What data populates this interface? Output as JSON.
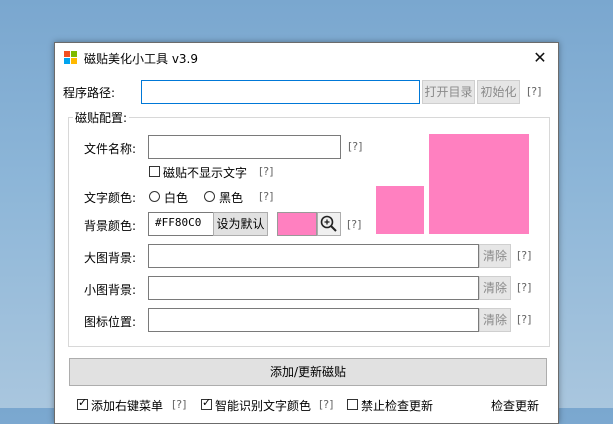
{
  "window": {
    "title": "磁贴美化小工具 v3.9",
    "close_glyph": "✕"
  },
  "program_path": {
    "label": "程序路径:",
    "value": "",
    "open_dir_button": "打开目录",
    "init_button": "初始化",
    "help": "[?]"
  },
  "tile_config": {
    "group_title": "磁贴配置:",
    "file_name": {
      "label": "文件名称:",
      "value": "",
      "help": "[?]"
    },
    "hide_text": {
      "label": "磁贴不显示文字",
      "checked": false,
      "help": "[?]"
    },
    "text_color": {
      "label": "文字颜色:",
      "options": [
        "白色",
        "黑色"
      ],
      "selected": null,
      "help": "[?]"
    },
    "bg_color": {
      "label": "背景颜色:",
      "value": "#FF80C0",
      "set_default_button": "设为默认",
      "swatch_color": "#ff80c0",
      "picker_icon": "zoom-icon",
      "help": "[?]"
    },
    "large_bg": {
      "label": "大图背景:",
      "value": "",
      "clear_button": "清除",
      "help": "[?]"
    },
    "small_bg": {
      "label": "小图背景:",
      "value": "",
      "clear_button": "清除",
      "help": "[?]"
    },
    "icon_pos": {
      "label": "图标位置:",
      "value": "",
      "clear_button": "清除",
      "help": "[?]"
    },
    "preview_color": "#ff80c0"
  },
  "add_update_button": "添加/更新磁贴",
  "footer": {
    "items": [
      {
        "label": "添加右键菜单",
        "checked": true,
        "help": "[?]"
      },
      {
        "label": "智能识别文字颜色",
        "checked": true,
        "help": "[?]"
      },
      {
        "label": "禁止检查更新",
        "checked": false
      }
    ],
    "check_update_link": "检查更新"
  }
}
